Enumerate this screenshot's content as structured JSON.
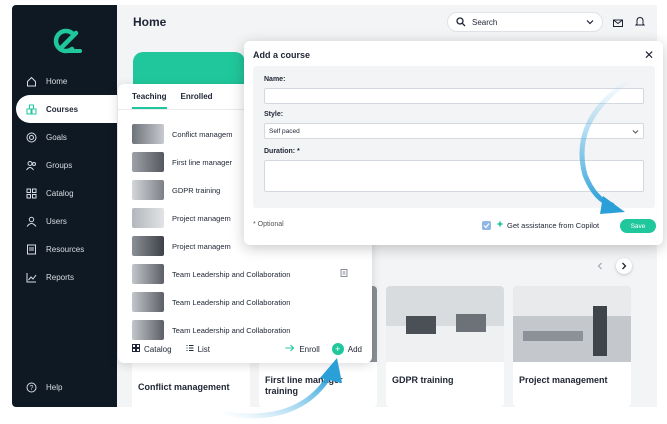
{
  "sidebar": {
    "items": [
      {
        "label": "Home",
        "icon": "home-icon"
      },
      {
        "label": "Courses",
        "icon": "courses-icon"
      },
      {
        "label": "Goals",
        "icon": "goals-icon"
      },
      {
        "label": "Groups",
        "icon": "groups-icon"
      },
      {
        "label": "Catalog",
        "icon": "catalog-icon"
      },
      {
        "label": "Users",
        "icon": "users-icon"
      },
      {
        "label": "Resources",
        "icon": "resources-icon"
      },
      {
        "label": "Reports",
        "icon": "reports-icon"
      }
    ],
    "help": "Help"
  },
  "header": {
    "title": "Home",
    "search_placeholder": "Search"
  },
  "panel": {
    "tabs": [
      "Teaching",
      "Enrolled"
    ],
    "courses": [
      "Conflict managem",
      "First line manager",
      "GDPR training",
      "Project managem",
      "Project managem",
      "Team Leadership and Collaboration",
      "Team Leadership and Collaboration",
      "Team Leadership and Collaboration"
    ],
    "footer": {
      "catalog": "Catalog",
      "list": "List",
      "enroll": "Enroll",
      "add": "Add"
    }
  },
  "modal": {
    "title": "Add a course",
    "name_label": "Name:",
    "name_value": "",
    "style_label": "Style:",
    "style_value": "Self paced",
    "duration_label": "Duration: *",
    "duration_value": "",
    "optional_note": "* Optional",
    "copilot_label": "Get assistance from Copilot",
    "copilot_checked": true,
    "save": "Save"
  },
  "cards": [
    "Conflict management",
    "First line manager training",
    "GDPR training",
    "Project management"
  ],
  "colors": {
    "accent": "#21c79c",
    "sidebar": "#0f1923",
    "arrow": "#5ab8e8"
  }
}
